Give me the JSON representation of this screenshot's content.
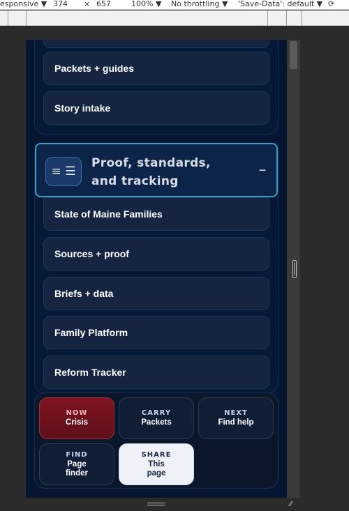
{
  "devtools": {
    "device_mode": "esponsive ▼",
    "width": "374",
    "times": "×",
    "height": "657",
    "zoom": "100% ▼",
    "throttling": "No throttling ▼",
    "save_data": "'Save-Data': default ▼"
  },
  "nav_top": [
    {
      "label": "Packets + guides"
    },
    {
      "label": "Story intake"
    }
  ],
  "section": {
    "icon": "≡ ☰",
    "title_line1": "Proof, standards,",
    "title_line2": "and tracking",
    "collapse": "−"
  },
  "section_items": [
    {
      "label": "State of Maine Families"
    },
    {
      "label": "Sources + proof"
    },
    {
      "label": "Briefs + data"
    },
    {
      "label": "Family Platform"
    },
    {
      "label": "Reform Tracker"
    }
  ],
  "dock": [
    {
      "kicker": "NOW",
      "label": "Crisis"
    },
    {
      "kicker": "CARRY",
      "label": "Packets"
    },
    {
      "kicker": "NEXT",
      "label": "Find help"
    },
    {
      "kicker": "FIND",
      "label": "Page finder"
    },
    {
      "kicker": "SHARE",
      "label": "This page"
    }
  ]
}
